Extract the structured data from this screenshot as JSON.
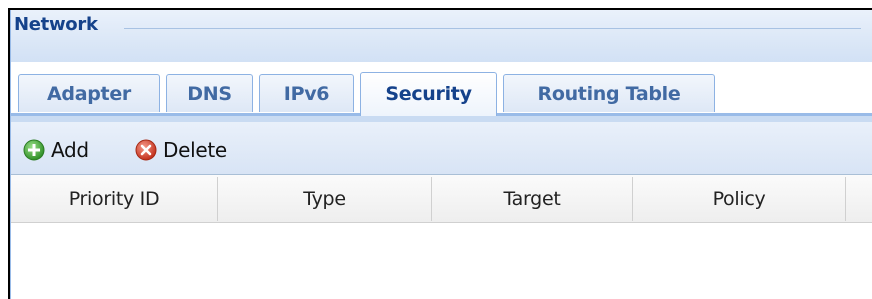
{
  "panel": {
    "title": "Network"
  },
  "tabs": [
    {
      "label": "Adapter",
      "active": false
    },
    {
      "label": "DNS",
      "active": false
    },
    {
      "label": "IPv6",
      "active": false
    },
    {
      "label": "Security",
      "active": true
    },
    {
      "label": "Routing Table",
      "active": false
    }
  ],
  "toolbar": {
    "add_label": "Add",
    "add_icon": "add-icon",
    "delete_label": "Delete",
    "delete_icon": "delete-icon"
  },
  "grid": {
    "columns": [
      "Priority ID",
      "Type",
      "Target",
      "Policy"
    ],
    "rows": []
  },
  "colors": {
    "title": "#15428b",
    "tab_text": "#416aa3",
    "border_blue": "#99bbe8",
    "add_green": "#3fa535",
    "delete_red": "#d9432e"
  }
}
